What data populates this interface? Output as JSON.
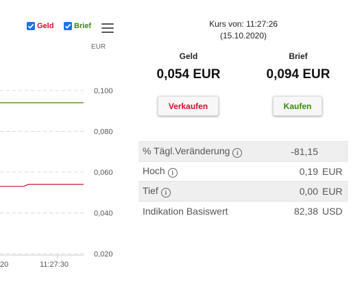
{
  "chart": {
    "legend": [
      {
        "label": "Geld",
        "checked": true,
        "color": "#c8102e"
      },
      {
        "label": "Brief",
        "checked": true,
        "color": "#3a8a0a"
      }
    ],
    "unit": "EUR"
  },
  "chart_data": {
    "type": "line",
    "x_tick_labels": [
      "20",
      "11:27:30"
    ],
    "y_ticks": [
      "0,100",
      "0,080",
      "0,060",
      "0,040",
      "0,020"
    ],
    "ylim": [
      0.02,
      0.1
    ],
    "ylabel": "EUR",
    "grid": true,
    "series": [
      {
        "name": "Brief",
        "color": "#3a8a0a",
        "points": [
          {
            "x": 0,
            "y": 0.094
          },
          {
            "x": 1,
            "y": 0.094
          }
        ]
      },
      {
        "name": "Geld",
        "color": "#c8102e",
        "points": [
          {
            "x": 0,
            "y": 0.053
          },
          {
            "x": 0.28,
            "y": 0.053
          },
          {
            "x": 0.34,
            "y": 0.054
          },
          {
            "x": 1,
            "y": 0.054
          }
        ]
      }
    ]
  },
  "quote": {
    "timestamp_label": "Kurs von: 11:27:26",
    "timestamp_date": "(15.10.2020)",
    "geld_label": "Geld",
    "geld_value": "0,054 EUR",
    "brief_label": "Brief",
    "brief_value": "0,094 EUR",
    "sell_button": "Verkaufen",
    "buy_button": "Kaufen"
  },
  "info_rows": [
    {
      "label": "% Tägl.Veränderung",
      "info_icon": true,
      "value": "-81,15",
      "unit": ""
    },
    {
      "label": "Hoch",
      "info_icon": true,
      "value": "0,19",
      "unit": "EUR"
    },
    {
      "label": "Tief",
      "info_icon": true,
      "value": "0,00",
      "unit": "EUR"
    },
    {
      "label": "Indikation Basiswert",
      "info_icon": false,
      "value": "82,38",
      "unit": "USD"
    }
  ]
}
